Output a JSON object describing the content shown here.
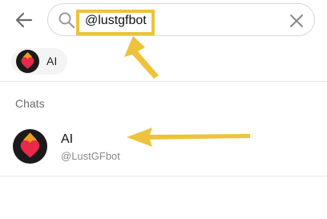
{
  "search": {
    "query": "@lustgfbot",
    "back_icon": "arrow-left-icon",
    "search_icon": "magnifier-icon",
    "clear_icon": "close-x-icon"
  },
  "recent": {
    "items": [
      {
        "label": "AI",
        "avatar_icon": "flaming-heart-icon"
      }
    ]
  },
  "chats_section": {
    "header": "Chats",
    "results": [
      {
        "title": "AI",
        "username": "@LustGFbot",
        "avatar_icon": "flaming-heart-icon"
      }
    ]
  },
  "colors": {
    "annotation": "#ecc33a",
    "heart": "#e8294a",
    "flame": "#f29a1d",
    "avatar_bg": "#1a1a1a",
    "secondary_text": "#8a8a8a"
  }
}
